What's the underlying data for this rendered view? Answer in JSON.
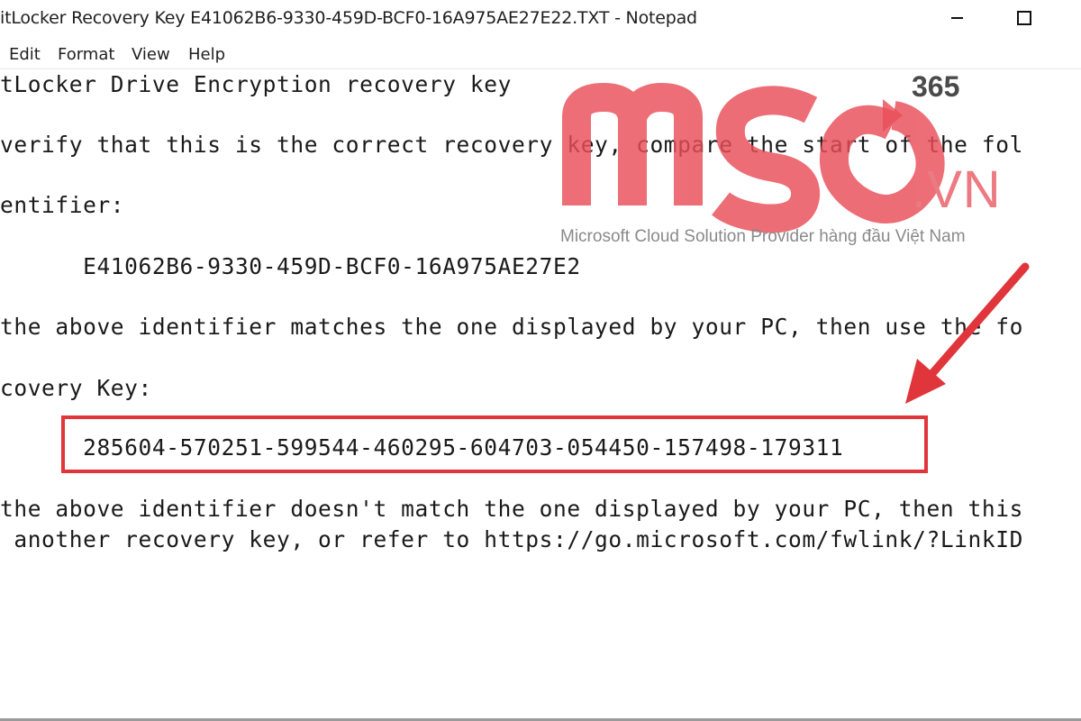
{
  "window": {
    "title": "itLocker Recovery Key E41062B6-9330-459D-BCF0-16A975AE27E22.TXT - Notepad"
  },
  "menu": {
    "items": [
      {
        "label": "Edit"
      },
      {
        "label": "Format"
      },
      {
        "label": "View"
      },
      {
        "label": "Help"
      }
    ]
  },
  "document": {
    "lines": [
      "tLocker Drive Encryption recovery key",
      "verify that this is the correct recovery key, compare the start of the fol",
      "entifier:",
      "      E41062B6-9330-459D-BCF0-16A975AE27E2",
      "the above identifier matches the one displayed by your PC, then use the fo",
      "covery Key:",
      "      285604-570251-599544-460295-604703-054450-157498-179311",
      "the above identifier doesn't match the one displayed by your PC, then this",
      " another recovery key, or refer to https://go.microsoft.com/fwlink/?LinkID"
    ]
  },
  "watermark": {
    "brand": "MSO",
    "suffix": ".VN",
    "badge": "365",
    "tagline": "Microsoft Cloud Solution Provider hàng đầu Việt Nam",
    "color": "#e94e59"
  },
  "annotation": {
    "color": "#e0353b"
  }
}
